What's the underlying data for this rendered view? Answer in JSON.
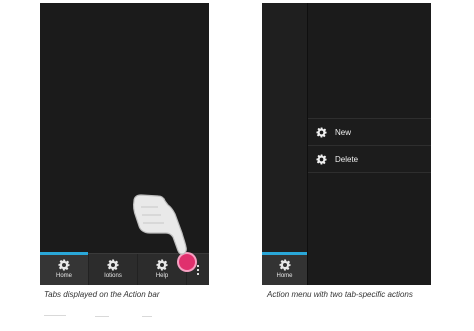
{
  "left_screen": {
    "tabs": [
      {
        "label": "Home",
        "icon": "gear-icon",
        "active": true
      },
      {
        "label": "Iotions",
        "icon": "gear-icon",
        "active": false
      },
      {
        "label": "Help",
        "icon": "gear-icon",
        "active": false
      }
    ],
    "overflow_icon": "more-vertical-icon",
    "caption": "Tabs displayed on the Action bar"
  },
  "right_screen": {
    "home_tab": {
      "label": "Home",
      "icon": "gear-icon"
    },
    "menu_items": [
      {
        "label": "New",
        "icon": "gear-icon"
      },
      {
        "label": "Delete",
        "icon": "gear-icon"
      }
    ],
    "caption": "Action menu with two tab-specific actions"
  },
  "colors": {
    "screen_bg": "#1b1b1b",
    "action_bar": "#2c2c2c",
    "accent": "#2aa7d8",
    "touch_indicator": "#e0306d"
  }
}
